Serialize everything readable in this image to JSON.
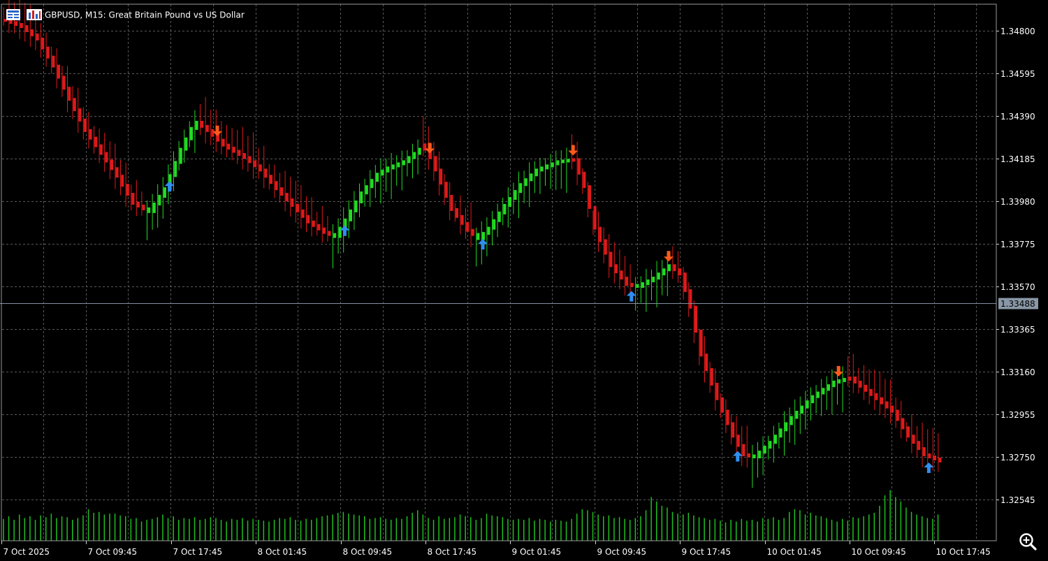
{
  "window": {
    "title": "GBPUSD, M15:  Great Britain Pound vs US Dollar",
    "icons": [
      "chart-menu-icon",
      "symbol-flag-icon",
      "zoom-in-icon"
    ]
  },
  "colors": {
    "background": "#000000",
    "grid": "#5a5a5a",
    "bull": "#22dd22",
    "bear": "#e01a1a",
    "volume": "#1fbf1f",
    "arrow_up": "#2e8ff0",
    "arrow_down": "#ff5a1a",
    "price_line": "#7f8fa0",
    "price_label_bg": "#8a97a6"
  },
  "chart_data": {
    "type": "line",
    "symbol": "GBPUSD",
    "timeframe": "M15",
    "y_ticks": [
      "1.34800",
      "1.34595",
      "1.34390",
      "1.34185",
      "1.33980",
      "1.33775",
      "1.33570",
      "1.33365",
      "1.33160",
      "1.32955",
      "1.32750",
      "1.32545"
    ],
    "ylim": [
      1.3245,
      1.3488
    ],
    "x_ticks": [
      "7 Oct 2025",
      "7 Oct 09:45",
      "7 Oct 17:45",
      "8 Oct 01:45",
      "8 Oct 09:45",
      "8 Oct 17:45",
      "9 Oct 01:45",
      "9 Oct 09:45",
      "9 Oct 17:45",
      "10 Oct 01:45",
      "10 Oct 09:45",
      "10 Oct 17:45"
    ],
    "current_price": 1.33488,
    "current_price_label": "1.33488",
    "series": [
      {
        "kind": "smoothed_trend",
        "points": [
          [
            0,
            1.3485
          ],
          [
            3,
            1.3482
          ],
          [
            6,
            1.3476
          ],
          [
            9,
            1.3463
          ],
          [
            12,
            1.3447
          ],
          [
            15,
            1.3432
          ],
          [
            18,
            1.3421
          ],
          [
            21,
            1.341
          ],
          [
            24,
            1.3397
          ],
          [
            27,
            1.3393
          ],
          [
            30,
            1.3404
          ],
          [
            33,
            1.3423
          ],
          [
            35,
            1.3433
          ],
          [
            36,
            1.3436
          ],
          [
            38,
            1.3432
          ],
          [
            41,
            1.3425
          ],
          [
            45,
            1.3419
          ],
          [
            48,
            1.3413
          ],
          [
            51,
            1.3404
          ],
          [
            54,
            1.3396
          ],
          [
            57,
            1.3388
          ],
          [
            60,
            1.3383
          ],
          [
            62,
            1.3381
          ],
          [
            64,
            1.3389
          ],
          [
            67,
            1.3402
          ],
          [
            70,
            1.3411
          ],
          [
            72,
            1.3414
          ],
          [
            75,
            1.3417
          ],
          [
            77,
            1.3421
          ],
          [
            79,
            1.3425
          ],
          [
            81,
            1.3413
          ],
          [
            84,
            1.3394
          ],
          [
            87,
            1.3384
          ],
          [
            89,
            1.338
          ],
          [
            91,
            1.3385
          ],
          [
            94,
            1.3396
          ],
          [
            97,
            1.3406
          ],
          [
            100,
            1.3413
          ],
          [
            104,
            1.3417
          ],
          [
            107,
            1.3418
          ],
          [
            109,
            1.3405
          ],
          [
            111,
            1.3385
          ],
          [
            114,
            1.3367
          ],
          [
            117,
            1.3358
          ],
          [
            119,
            1.3357
          ],
          [
            122,
            1.3361
          ],
          [
            125,
            1.3367
          ],
          [
            127,
            1.3363
          ],
          [
            129,
            1.3347
          ],
          [
            131,
            1.3324
          ],
          [
            134,
            1.3303
          ],
          [
            137,
            1.3285
          ],
          [
            139,
            1.3276
          ],
          [
            141,
            1.3275
          ],
          [
            144,
            1.3282
          ],
          [
            148,
            1.3294
          ],
          [
            152,
            1.3304
          ],
          [
            156,
            1.3311
          ],
          [
            159,
            1.3313
          ],
          [
            161,
            1.3309
          ],
          [
            164,
            1.3303
          ],
          [
            167,
            1.3297
          ],
          [
            170,
            1.3285
          ],
          [
            173,
            1.3276
          ],
          [
            176,
            1.3273
          ],
          [
            178,
            1.3281
          ],
          [
            180,
            1.3304
          ],
          [
            182,
            1.3333
          ],
          [
            184,
            1.3349
          ],
          [
            186,
            1.336
          ],
          [
            188,
            1.3364
          ]
        ]
      },
      {
        "kind": "signal_arrows",
        "up_bars": [
          31,
          64,
          90,
          118,
          138,
          174
        ],
        "down_bars": [
          40,
          80,
          107,
          125,
          157
        ]
      },
      {
        "kind": "volume",
        "values": [
          25,
          28,
          24,
          30,
          26,
          28,
          24,
          29,
          27,
          31,
          26,
          28,
          27,
          24,
          26,
          29,
          36,
          32,
          33,
          30,
          31,
          31,
          29,
          28,
          25,
          26,
          22,
          24,
          25,
          27,
          30,
          26,
          28,
          24,
          26,
          25,
          27,
          24,
          25,
          27,
          26,
          24,
          22,
          25,
          24,
          26,
          23,
          25,
          24,
          23,
          22,
          24,
          26,
          25,
          27,
          24,
          23,
          25,
          24,
          26,
          28,
          29,
          30,
          32,
          33,
          31,
          30,
          29,
          28,
          25,
          26,
          27,
          25,
          24,
          26,
          25,
          28,
          32,
          35,
          30,
          26,
          24,
          28,
          25,
          26,
          27,
          30,
          28,
          27,
          24,
          26,
          31,
          29,
          28,
          27,
          25,
          24,
          25,
          24,
          26,
          23,
          25,
          24,
          22,
          24,
          23,
          22,
          25,
          31,
          36,
          35,
          33,
          30,
          28,
          29,
          26,
          27,
          25,
          24,
          26,
          28,
          35,
          50,
          45,
          40,
          38,
          33,
          31,
          30,
          32,
          29,
          27,
          26,
          24,
          25,
          23,
          21,
          24,
          22,
          25,
          23,
          24,
          22,
          26,
          25,
          27,
          24,
          26,
          33,
          36,
          35,
          30,
          32,
          29,
          28,
          26,
          24,
          22,
          25,
          23,
          27,
          26,
          28,
          30,
          32,
          40,
          52,
          58,
          50,
          45,
          38,
          33,
          30,
          28,
          26,
          25,
          30
        ]
      }
    ]
  }
}
